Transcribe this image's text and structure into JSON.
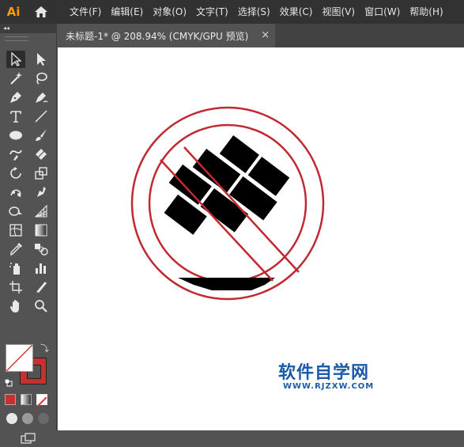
{
  "app": {
    "logo": "Ai",
    "home_icon": "home-icon"
  },
  "menu": {
    "items": [
      "文件(F)",
      "编辑(E)",
      "对象(O)",
      "文字(T)",
      "选择(S)",
      "效果(C)",
      "视图(V)",
      "窗口(W)",
      "帮助(H)"
    ]
  },
  "panel": {
    "collapse": "◂◂"
  },
  "document": {
    "tab_title": "未标题-1* @ 208.94% (CMYK/GPU 预览)",
    "close": "×"
  },
  "watermark": {
    "text": "软件自学网",
    "url": "WWW.RJZXW.COM"
  },
  "colors": {
    "accent_ai": "#ff9a00",
    "circle_stroke": "#c0292f",
    "artwork_fill": "#000000",
    "watermark": "#1a5aa8",
    "stroke_swatch": "#c53030"
  },
  "tools": {
    "icons": [
      "selection-icon",
      "direct-selection-icon",
      "magic-wand-icon",
      "lasso-icon",
      "pen-icon",
      "curvature-icon",
      "type-icon",
      "line-segment-icon",
      "ellipse-icon",
      "paintbrush-icon",
      "shaper-icon",
      "eraser-icon",
      "rotate-icon",
      "scale-icon",
      "puppet-warp-icon",
      "free-transform-icon",
      "shape-builder-icon",
      "perspective-grid-icon",
      "mesh-icon",
      "gradient-icon",
      "eyedropper-icon",
      "blend-icon",
      "symbol-sprayer-icon",
      "column-graph-icon",
      "artboard-icon",
      "slice-icon",
      "hand-icon",
      "zoom-icon"
    ]
  }
}
